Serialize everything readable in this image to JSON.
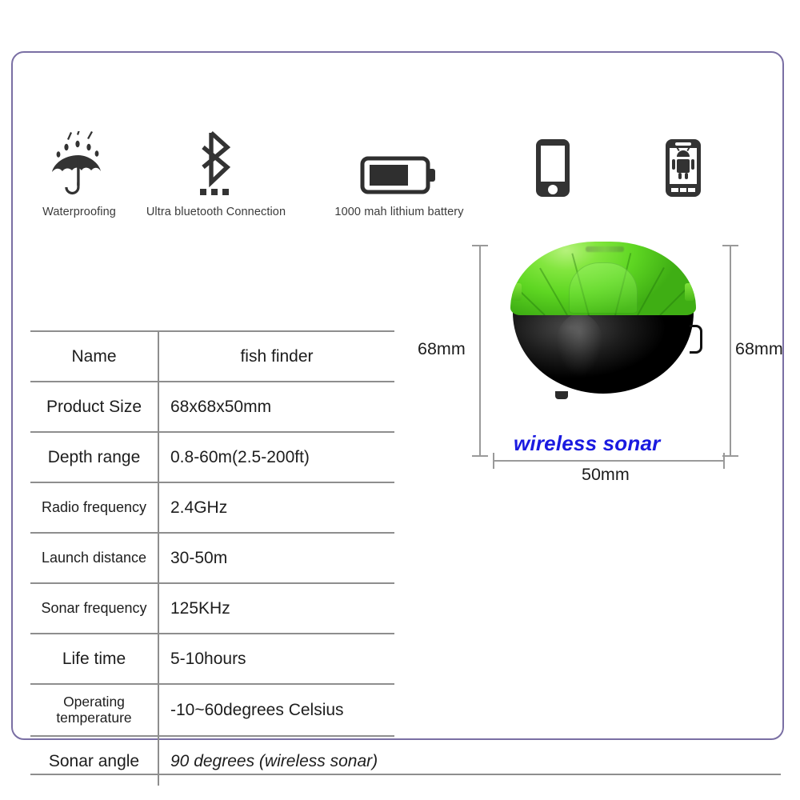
{
  "features": [
    {
      "id": "waterproofing",
      "icon": "umbrella-rain-icon",
      "label": "Waterproofing"
    },
    {
      "id": "bluetooth",
      "icon": "bluetooth-icon",
      "label": "Ultra bluetooth Connection"
    },
    {
      "id": "battery",
      "icon": "battery-icon",
      "label": "1000 mah lithium battery"
    },
    {
      "id": "ios-phone",
      "icon": "iphone-icon",
      "label": ""
    },
    {
      "id": "android-phone",
      "icon": "android-phone-icon",
      "label": ""
    }
  ],
  "spec_table": {
    "rows": [
      {
        "key": "Name",
        "value": "fish finder",
        "value_align": "center",
        "value_style": "normal"
      },
      {
        "key": "Product Size",
        "value": "68x68x50mm",
        "value_align": "left",
        "value_style": "normal"
      },
      {
        "key": "Depth range",
        "value": "0.8-60m(2.5-200ft)",
        "value_align": "left",
        "value_style": "normal"
      },
      {
        "key": "Radio frequency",
        "value": "2.4GHz",
        "value_align": "left",
        "value_style": "normal"
      },
      {
        "key": "Launch distance",
        "value": "30-50m",
        "value_align": "left",
        "value_style": "normal"
      },
      {
        "key": "Sonar frequency",
        "value": "125KHz",
        "value_align": "left",
        "value_style": "normal"
      },
      {
        "key": "Life time",
        "value": "5-10hours",
        "value_align": "left",
        "value_style": "normal"
      },
      {
        "key": "Operating temperature",
        "value": "-10~60degrees Celsius",
        "value_align": "left",
        "value_style": "normal"
      },
      {
        "key": "Sonar angle",
        "value": "90 degrees (wireless sonar)",
        "value_align": "left",
        "value_style": "italic"
      }
    ]
  },
  "product": {
    "brand_text": "wireless sonar",
    "dimensions": {
      "height_left": "68mm",
      "height_right": "68mm",
      "width_bottom": "50mm"
    }
  },
  "colors": {
    "frame_border": "#7a6fa4",
    "table_rule": "#8e8e8e",
    "dimension_line": "#9a9a9a",
    "brand_blue": "#1a1ae0",
    "dome_green": "#5ed622",
    "body_black": "#111111",
    "caption_gray": "#3b3b3b"
  }
}
